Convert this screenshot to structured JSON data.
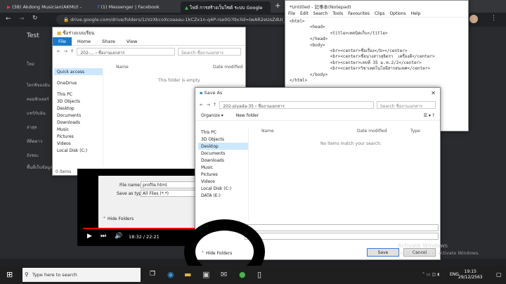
{
  "browser": {
    "tabs": [
      {
        "label": "(38) Akdong Musician(AKMU) - "
      },
      {
        "label": "(1) Messenger | Facebook"
      },
      {
        "label": "ไฟล์ การสร้างเว็บไซต์ ระบบ Google"
      }
    ],
    "url": "drive.google.com/drive/folders/1zVzXkcoXcoaaau-1kCZx1n-q4P-rse0G?lbclid=IwAR2eUsZdUr_fV-G"
  },
  "drive_sidebar": {
    "items": [
      "Test",
      "ใหม่",
      "ไดรฟ์ของฉัน",
      "คอมพิวเตอร์",
      "แชร์กับฉัน",
      "ล่าสุด",
      "ที่ติดดาว",
      "ถังขยะ",
      "พื้นที่เก็บข้อมูล"
    ]
  },
  "explorer": {
    "title": "ชื่อร่างแบบเรียน",
    "ribbon": [
      "File",
      "Home",
      "Share",
      "View"
    ],
    "path": "202-... › ชื่องานเอกสาร",
    "search_placeholder": "Search ชื่องานเอกสาร",
    "nav": [
      "Quick access",
      "OneDrive",
      "This PC",
      "3D Objects",
      "Desktop",
      "Documents",
      "Downloads",
      "Music",
      "Pictures",
      "Videos",
      "Local Disk (C:)"
    ],
    "columns": [
      "Name",
      "Date modified"
    ],
    "empty_text": "This folder is empty.",
    "status": "0 items"
  },
  "notepad": {
    "title": "*Untitled - 記事本(Notepad)",
    "menu": [
      "File",
      "Edit",
      "Search",
      "Tools",
      "Favourites",
      "Clips",
      "Options",
      "Help"
    ],
    "code": [
      "<html>",
      "        <head>",
      "                <title>เทคนิคเก็บ</title>",
      "        </head>",
      "        <body>",
      "                <br><center>ชื่อเรื่อง</b></center>",
      "                <br><center>ชื่อนางสาวสุจิตรา  เครื่องดี</center>",
      "                <br><center>เลขที่ 35 ม.ท.2/2</center>",
      "                <br><center>วิชาเทคโนโลยีสารสนเทศ</center>",
      "        </body>",
      "</html>"
    ]
  },
  "video": {
    "time": "18:32 / 22:21",
    "progress": 0.55
  },
  "behind_dialog": {
    "file_name_label": "File name:",
    "file_name_value": "profile.html",
    "save_type_label": "Save as type:",
    "save_type_value": "All Files (*.*)",
    "hide_folders": "Hide Folders"
  },
  "save_as": {
    "title": "Save As",
    "path": "202-piyada-35 › ชื่องานเอกสาร",
    "search_placeholder": "Search ชื่องานเอกสาร",
    "organize": "Organize ▾",
    "new_folder": "New folder",
    "nav": [
      "This PC",
      "3D Objects",
      "Desktop",
      "Documents",
      "Downloads",
      "Music",
      "Pictures",
      "Videos",
      "Local Disk (C:)",
      "DATA (E:)"
    ],
    "columns": [
      "Name",
      "Date modified",
      "Type"
    ],
    "empty_text": "No items match your search.",
    "save_label": "Save",
    "cancel_label": "Cancel",
    "hide_folders": "Hide Folders"
  },
  "taskbar": {
    "search_placeholder": "Type here to search",
    "lang": "ENG",
    "time": "19:15",
    "date": "29/12/2563"
  },
  "watermark": {
    "line1": "Activate Windows",
    "line2": "Go to Settings to activate Windows."
  }
}
